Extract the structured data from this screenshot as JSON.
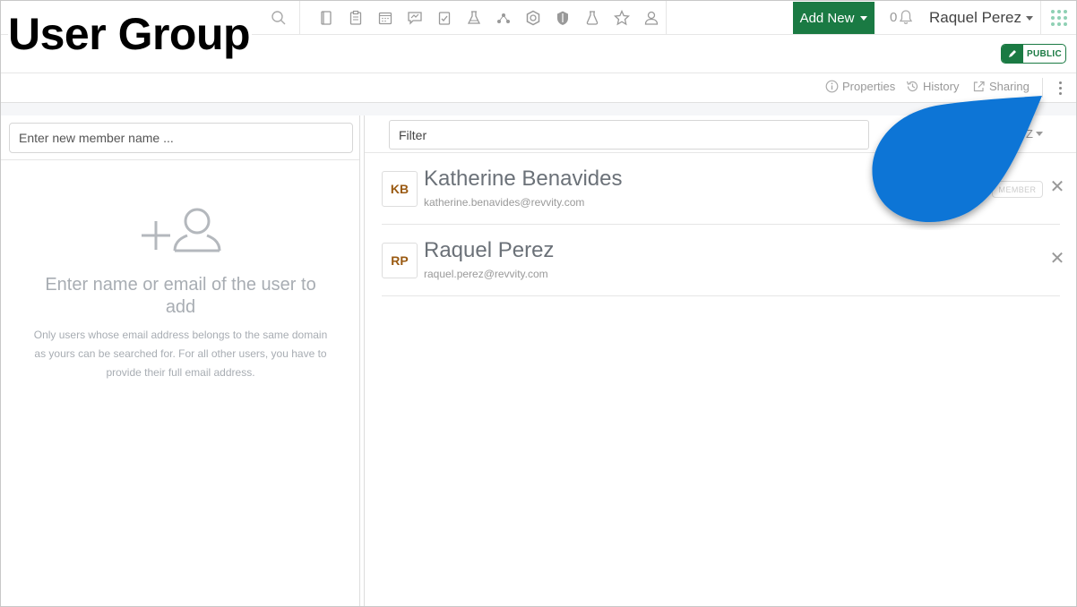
{
  "page": {
    "title": "User Group"
  },
  "topnav": {
    "add_new_label": "Add New",
    "notification_count": "0",
    "user_name": "Raquel Perez",
    "icons": [
      "notebook-icon",
      "clipboard-icon",
      "calendar-icon",
      "chat-chart-icon",
      "clipboard-check-icon",
      "lab-flask-icon",
      "network-icon",
      "hexagon-icon",
      "shield-icon",
      "beaker-icon",
      "star-icon",
      "users-icon"
    ]
  },
  "badge": {
    "public_label": "PUBLIC"
  },
  "toolbar": {
    "properties_label": "Properties",
    "history_label": "History",
    "sharing_label": "Sharing"
  },
  "left_panel": {
    "member_input_placeholder": "Enter new member name ...",
    "empty_title": "Enter name or email of the user to add",
    "empty_description": "Only users whose email address belongs to the same domain as yours can be searched for. For all other users, you have to provide their full email address."
  },
  "right_panel": {
    "filter_placeholder": "Filter",
    "sort_label": "Z",
    "members": [
      {
        "initials": "KB",
        "name": "Katherine Benavides",
        "email": "katherine.benavides@revvity.com",
        "role": "MEMBER",
        "remove": "✕"
      },
      {
        "initials": "RP",
        "name": "Raquel Perez",
        "email": "raquel.perez@revvity.com",
        "role": "",
        "remove": "✕"
      }
    ]
  },
  "colors": {
    "accent_green": "#1a7a43",
    "callout_blue": "#0a74d6"
  }
}
